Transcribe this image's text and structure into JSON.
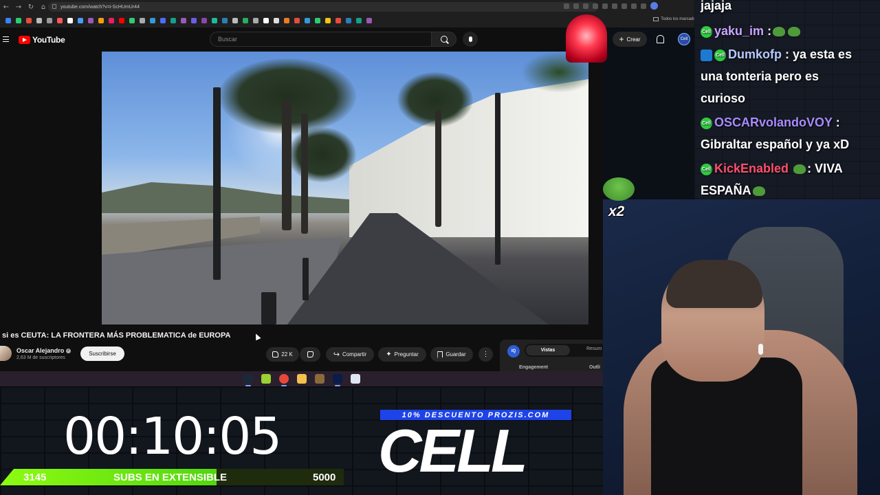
{
  "browser": {
    "url": "youtube.com/watch?v=i-ScHUmUr44",
    "bookmarks_folder": "Todos los marcadores",
    "bookmark_colors": [
      "#3b82f6",
      "#2ecc71",
      "#e74c3c",
      "#bbbbbb",
      "#999999",
      "#ff5555",
      "#ffffff",
      "#4b9bff",
      "#9b59b6",
      "#f39c12",
      "#e91e63",
      "#ff0000",
      "#2ecc71",
      "#aaaaaa",
      "#3498db",
      "#4b6ef5",
      "#16a085",
      "#9b59b6",
      "#6c5ce7",
      "#8e44ad",
      "#1abc9c",
      "#2980b9",
      "#bbbbbb",
      "#27ae60",
      "#aaaaaa",
      "#ffffff",
      "#dddddd",
      "#e67e22",
      "#e74c3c",
      "#3498db",
      "#2ecc71",
      "#f1c40f",
      "#e74c3c",
      "#2980b9",
      "#16a085",
      "#9b59b6"
    ]
  },
  "youtube": {
    "logo_text": "YouTube",
    "search_placeholder": "Buscar",
    "create_label": "Crear",
    "create_symbol": "+",
    "avatar_text": "Cell",
    "video_title": "si es CEUTA: LA FRONTERA MÁS PROBLEMATICA de EUROPA",
    "channel_name": "Oscar Alejandro",
    "verified_mark": "✓",
    "subscribers": "2,63 M de suscriptores",
    "subscribe_label": "Suscribirse",
    "likes": "22 K",
    "share_label": "Compartir",
    "ask_label": "Preguntar",
    "save_label": "Guardar",
    "more_symbol": "⋮",
    "panel": {
      "badge": "IQ",
      "tab_active": "Vistas",
      "tab_other": "Resum",
      "engagement": "Engagement",
      "outline": "Outli"
    }
  },
  "taskbar": {
    "apps": [
      {
        "name": "steam",
        "color": "#1b2838"
      },
      {
        "name": "xbox",
        "color": "#9bd132"
      },
      {
        "name": "chrome",
        "color": "#e8483b"
      },
      {
        "name": "file-explorer",
        "color": "#f2c14e"
      },
      {
        "name": "minecraft",
        "color": "#8a6a3b"
      },
      {
        "name": "photoshop",
        "color": "#0b1b4a"
      },
      {
        "name": "app-7",
        "color": "#dfe6f3"
      }
    ]
  },
  "overlay": {
    "timer": "00:10:05",
    "subs_current": "3145",
    "subs_label": "SUBS EN EXTENSIBLE",
    "subs_goal": "5000",
    "subs_progress": 0.629,
    "promo": "10% DESCUENTO PROZIS.COM",
    "brand": "CELL"
  },
  "chat": [
    {
      "user": "",
      "text": "jajaja",
      "user_color": "#ffffff"
    },
    {
      "user": "yaku_im",
      "text": ":",
      "user_color": "#c9a6ff",
      "badge": "green"
    },
    {
      "user": "Dumkofp",
      "text": ": ya esta es",
      "user_color": "#b8c8ff",
      "badge": "blue-green"
    },
    {
      "user": "",
      "text": "una tonteria pero es",
      "user_color": "#ffffff"
    },
    {
      "user": "",
      "text": "curioso",
      "user_color": "#ffffff"
    },
    {
      "user": "OSCARvolandoVOY",
      "text": ":",
      "user_color": "#a98bff",
      "badge": "green"
    },
    {
      "user": "",
      "text": "Gibraltar español y ya xD",
      "user_color": "#ffffff"
    },
    {
      "user": "KickEnabled",
      "text": ": VIVA",
      "user_color": "#ff4f6d",
      "badge": "green"
    },
    {
      "user": "",
      "text": "ESPAÑA",
      "user_color": "#ffffff"
    }
  ],
  "emote_multiplier": "x2",
  "badge_text": "Cell"
}
